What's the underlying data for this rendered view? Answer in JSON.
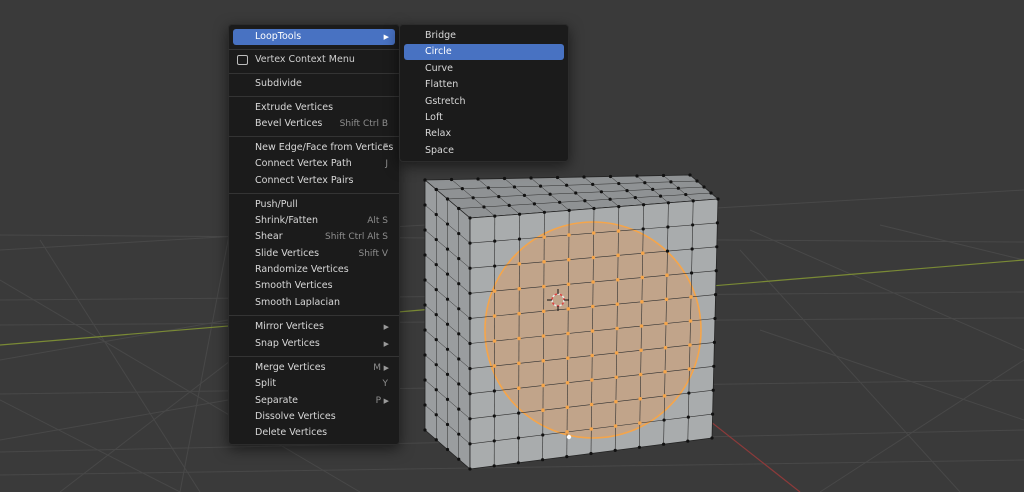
{
  "context_menu": {
    "loop_tools": "LoopTools",
    "title": "Vertex Context Menu",
    "items": [
      {
        "label": "Subdivide",
        "shortcut": ""
      },
      {
        "label": "Extrude Vertices",
        "shortcut": ""
      },
      {
        "label": "Bevel Vertices",
        "shortcut": "Shift Ctrl B"
      },
      {
        "label": "New Edge/Face from Vertices",
        "shortcut": "F"
      },
      {
        "label": "Connect Vertex Path",
        "shortcut": "J"
      },
      {
        "label": "Connect Vertex Pairs",
        "shortcut": ""
      },
      {
        "label": "Push/Pull",
        "shortcut": ""
      },
      {
        "label": "Shrink/Fatten",
        "shortcut": "Alt S"
      },
      {
        "label": "Shear",
        "shortcut": "Shift Ctrl Alt S"
      },
      {
        "label": "Slide Vertices",
        "shortcut": "Shift V"
      },
      {
        "label": "Randomize Vertices",
        "shortcut": ""
      },
      {
        "label": "Smooth Vertices",
        "shortcut": ""
      },
      {
        "label": "Smooth Laplacian",
        "shortcut": ""
      },
      {
        "label": "Mirror Vertices",
        "shortcut": ""
      },
      {
        "label": "Snap Vertices",
        "shortcut": ""
      },
      {
        "label": "Merge Vertices",
        "shortcut": "M"
      },
      {
        "label": "Split",
        "shortcut": "Y"
      },
      {
        "label": "Separate",
        "shortcut": "P"
      },
      {
        "label": "Dissolve Vertices",
        "shortcut": ""
      },
      {
        "label": "Delete Vertices",
        "shortcut": ""
      }
    ]
  },
  "submenu": {
    "items": [
      "Bridge",
      "Circle",
      "Curve",
      "Flatten",
      "Gstretch",
      "Loft",
      "Relax",
      "Space"
    ],
    "selected": "Circle"
  },
  "colors": {
    "viewport_bg": "#3a3a3a",
    "menu_bg": "#1b1b1b",
    "highlight": "#4872c2",
    "selection": "#f5a54a"
  }
}
